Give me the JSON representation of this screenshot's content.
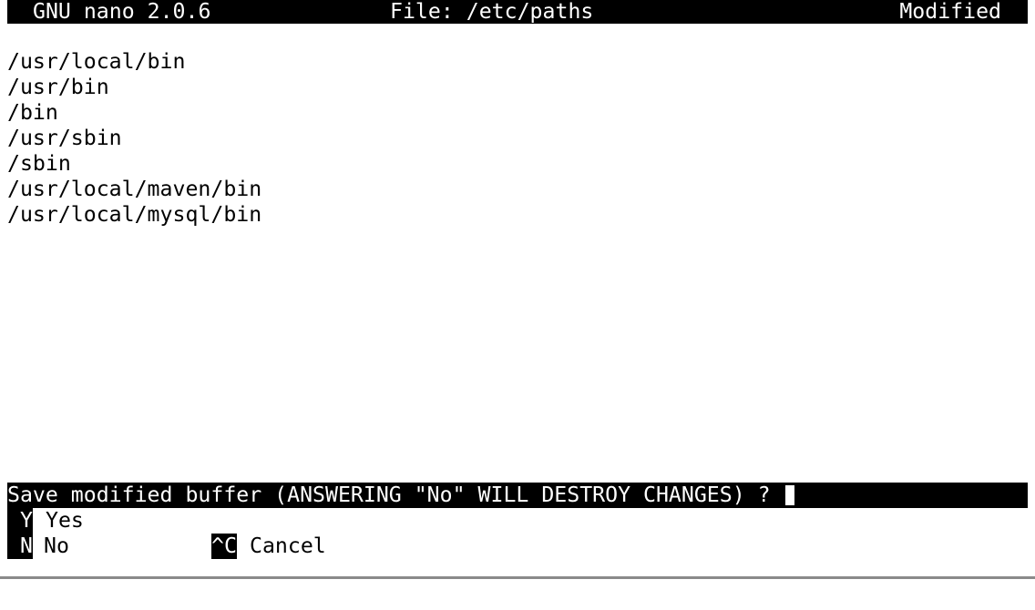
{
  "title_bar": {
    "app_version": "GNU nano 2.0.6",
    "file": "File: /etc/paths",
    "status": "Modified"
  },
  "buffer": {
    "lines": [
      "/usr/local/bin",
      "/usr/bin",
      "/bin",
      "/usr/sbin",
      "/sbin",
      "/usr/local/maven/bin",
      "/usr/local/mysql/bin"
    ]
  },
  "prompt": {
    "text": "Save modified buffer (ANSWERING \"No\" WILL DESTROY CHANGES) ? "
  },
  "options": {
    "yes_key": "Y",
    "yes_label": "Yes",
    "no_key": "N",
    "no_label": "No",
    "cancel_key": "^C",
    "cancel_label": "Cancel"
  }
}
